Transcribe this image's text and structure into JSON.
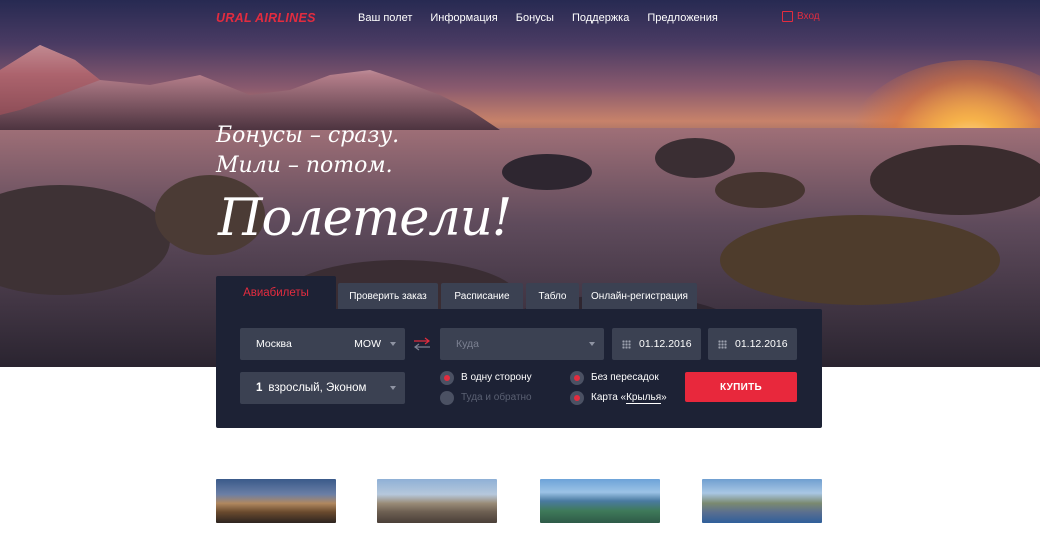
{
  "header": {
    "logo": "URAL AIRLINES",
    "nav": [
      "Ваш полет",
      "Информация",
      "Бонусы",
      "Поддержка",
      "Предложения"
    ],
    "login_label": "Вход"
  },
  "hero": {
    "slogan_line1": "Бонусы – сразу.",
    "slogan_line2": "Мили – потом.",
    "headline": "Полетели!"
  },
  "tabs": {
    "active": "Авиабилеты",
    "items": [
      "Проверить заказ",
      "Расписание",
      "Табло",
      "Онлайн-регистрация"
    ]
  },
  "search": {
    "from_city": "Москва",
    "from_code": "MOW",
    "to_placeholder": "Куда",
    "date_depart": "01.12.2016",
    "date_return": "01.12.2016",
    "passengers_count": "1",
    "passengers_label": "взрослый, Эконом",
    "trip_one_way": "В одну сторону",
    "trip_round": "Туда и обратно",
    "nonstop": "Без пересадок",
    "card_prefix": "Карта «",
    "card_link": "Крылья",
    "card_suffix": "»",
    "buy_label": "КУПИТЬ"
  },
  "destination_cards": [
    "barcelona-photo",
    "munich-photo",
    "resort-coast-photo",
    "amalfi-coast-photo"
  ],
  "colors": {
    "accent": "#e32c3f",
    "panel": "#1d2235",
    "field": "#3b4152"
  }
}
